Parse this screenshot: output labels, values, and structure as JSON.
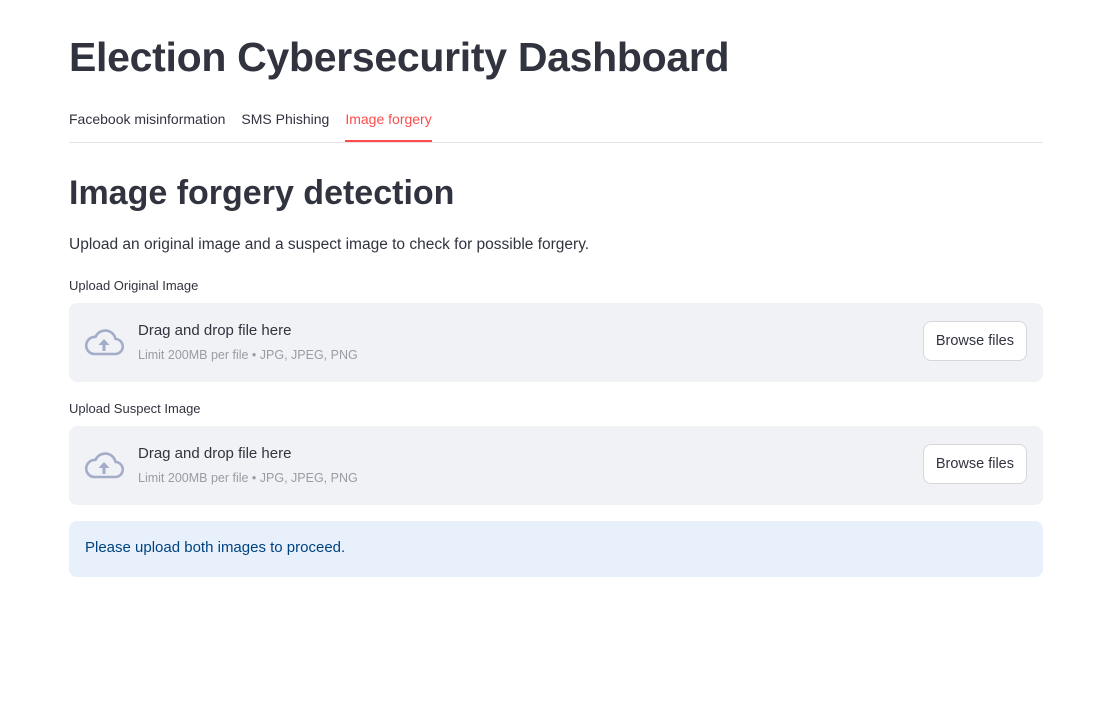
{
  "app": {
    "title": "Election Cybersecurity Dashboard"
  },
  "tabs": [
    {
      "label": "Facebook misinformation",
      "active": false
    },
    {
      "label": "SMS Phishing",
      "active": false
    },
    {
      "label": "Image forgery",
      "active": true
    }
  ],
  "section": {
    "title": "Image forgery detection",
    "description": "Upload an original image and a suspect image to check for possible forgery."
  },
  "uploaders": [
    {
      "label": "Upload Original Image",
      "drop_text": "Drag and drop file here",
      "limit_text": "Limit 200MB per file • JPG, JPEG, PNG",
      "button_label": "Browse files",
      "icon": "cloud-upload-icon"
    },
    {
      "label": "Upload Suspect Image",
      "drop_text": "Drag and drop file here",
      "limit_text": "Limit 200MB per file • JPG, JPEG, PNG",
      "button_label": "Browse files",
      "icon": "cloud-upload-icon"
    }
  ],
  "info": {
    "message": "Please upload both images to proceed."
  },
  "colors": {
    "accent": "#ff4b4b",
    "text": "#31333f",
    "dropzone_bg": "#f0f2f6",
    "info_bg": "#e8f1fb",
    "info_text": "#004280",
    "icon": "#a3acc9"
  }
}
